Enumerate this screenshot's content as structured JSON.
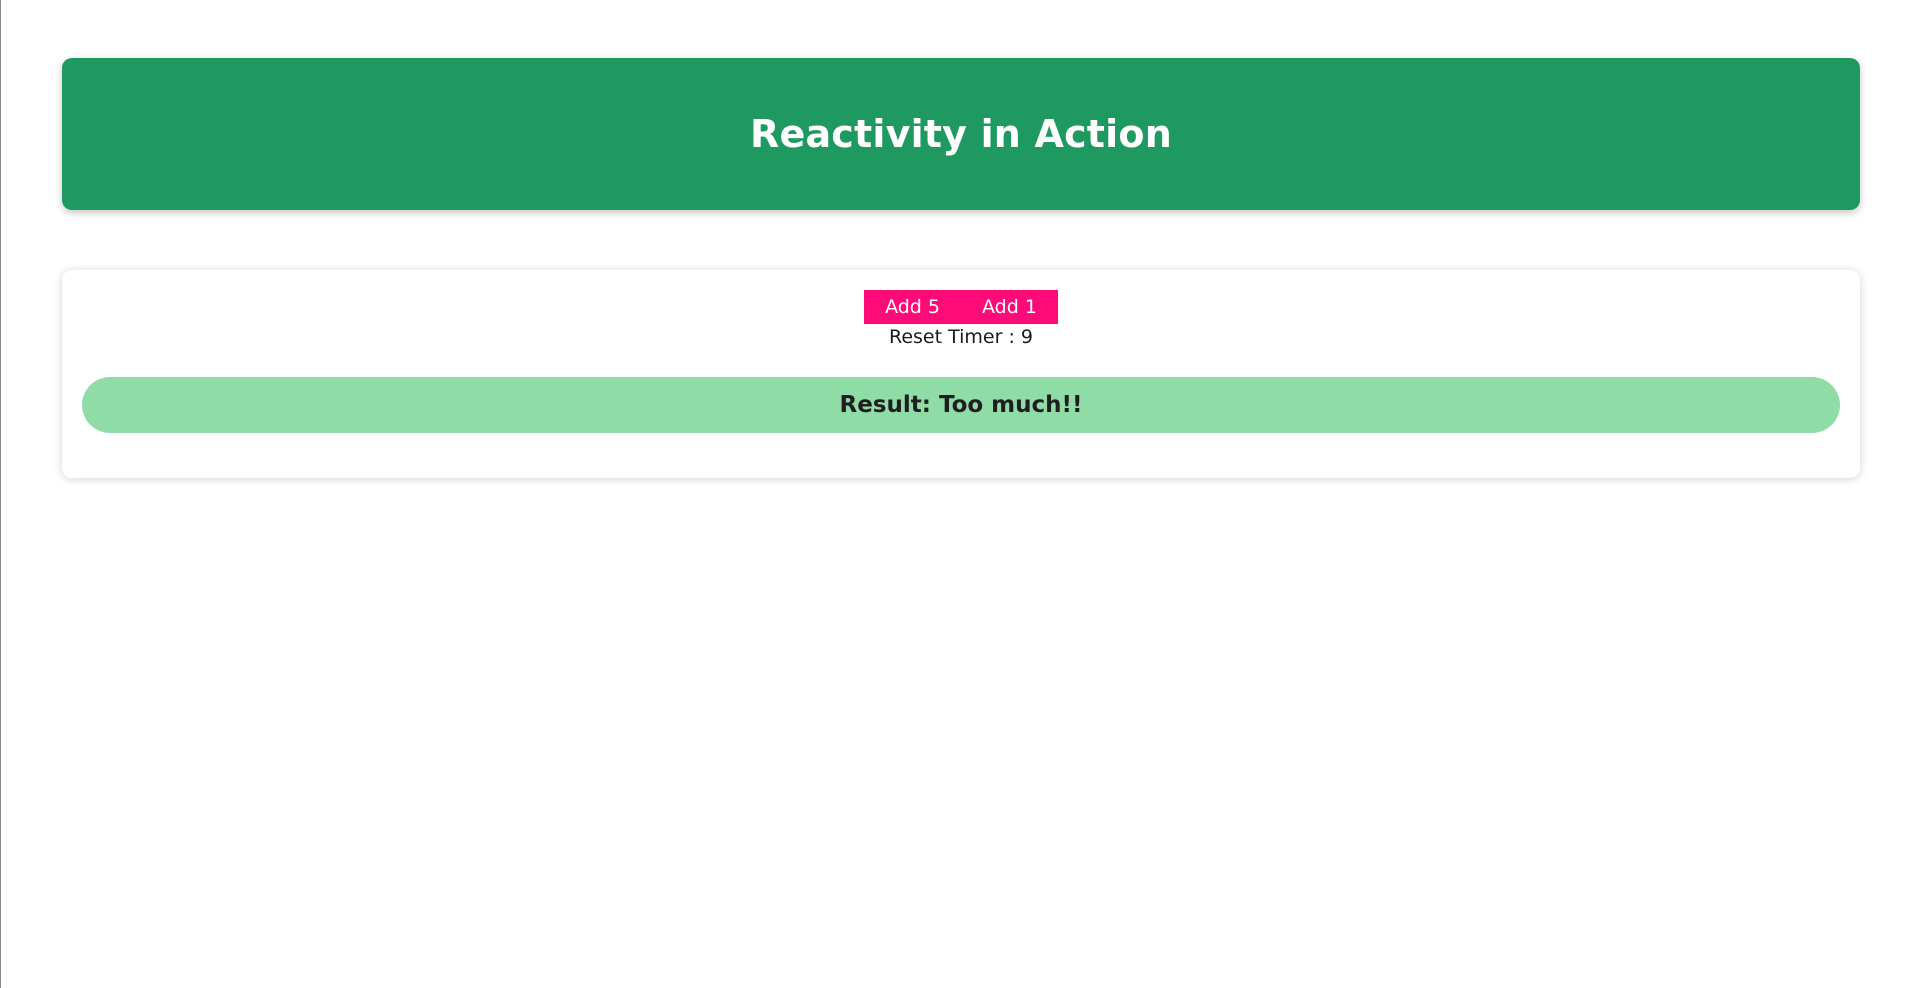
{
  "header": {
    "title": "Reactivity in Action"
  },
  "controls": {
    "add5_label": "Add 5",
    "add1_label": "Add 1",
    "timer_label": "Reset Timer :",
    "timer_value": "9"
  },
  "result": {
    "text": "Result: Too much!!"
  },
  "colors": {
    "header_bg": "#1e9a60",
    "button_bg": "#ff0a79",
    "result_bg": "#8fdca7"
  }
}
